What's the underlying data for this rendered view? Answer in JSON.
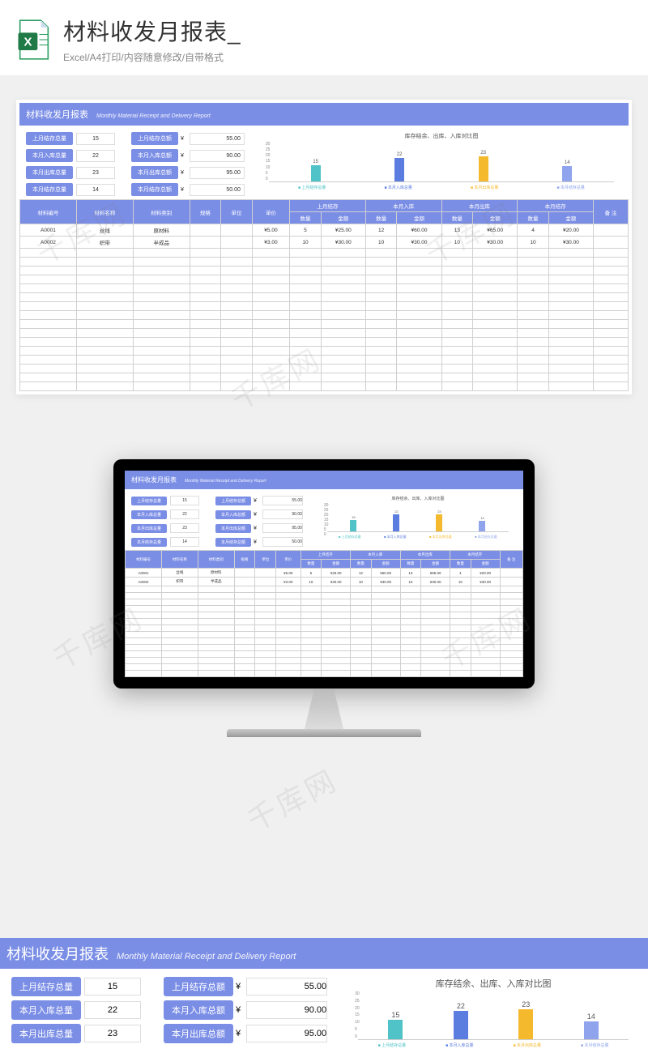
{
  "header": {
    "title": "材料收发月报表_",
    "subtitle": "Excel/A4打印/内容随意修改/自带格式"
  },
  "sheet": {
    "title_cn": "材料收发月报表",
    "title_en": "Monthly Material Receipt and Delivery Report",
    "summary_qty": [
      {
        "label": "上月结存总量",
        "value": "15"
      },
      {
        "label": "本月入库总量",
        "value": "22"
      },
      {
        "label": "本月出库总量",
        "value": "23"
      },
      {
        "label": "本月结存总量",
        "value": "14"
      }
    ],
    "summary_amt": [
      {
        "label": "上月结存总额",
        "value": "55.00"
      },
      {
        "label": "本月入库总额",
        "value": "90.00"
      },
      {
        "label": "本月出库总额",
        "value": "95.00"
      },
      {
        "label": "本月结存总额",
        "value": "50.00"
      }
    ],
    "currency": "¥",
    "columns": {
      "id": "材料编号",
      "name": "材料名称",
      "cat": "材料类别",
      "spec": "规格",
      "unit": "单位",
      "price": "单价",
      "g1": "上月结存",
      "g2": "本月入库",
      "g3": "本月出库",
      "g4": "本月结存",
      "qty": "数量",
      "amt": "金额",
      "note": "备 注"
    },
    "rows": [
      {
        "id": "A0001",
        "name": "丝线",
        "cat": "原材料",
        "spec": "",
        "unit": "",
        "price": "¥5.00",
        "q1": "5",
        "a1": "¥25.00",
        "q2": "12",
        "a2": "¥60.00",
        "q3": "13",
        "a3": "¥65.00",
        "q4": "4",
        "a4": "¥20.00"
      },
      {
        "id": "A0002",
        "name": "织带",
        "cat": "半成品",
        "spec": "",
        "unit": "",
        "price": "¥3.00",
        "q1": "10",
        "a1": "¥30.00",
        "q2": "10",
        "a2": "¥30.00",
        "q3": "10",
        "a3": "¥30.00",
        "q4": "10",
        "a4": "¥30.00"
      }
    ]
  },
  "chart_data": {
    "type": "bar",
    "title": "库存结余、出库、入库对比图",
    "categories": [
      "上月结存总量",
      "本月入库总量",
      "本月出库总量",
      "本月结存总量"
    ],
    "values": [
      15,
      22,
      23,
      14
    ],
    "colors": [
      "#4fc3c7",
      "#5b7de0",
      "#f5b92e",
      "#8fa4ec"
    ],
    "ylim": [
      0,
      30
    ],
    "yticks": [
      0,
      5,
      10,
      15,
      20,
      25,
      30
    ],
    "legend_prefix": "■"
  },
  "watermark": "千库网"
}
